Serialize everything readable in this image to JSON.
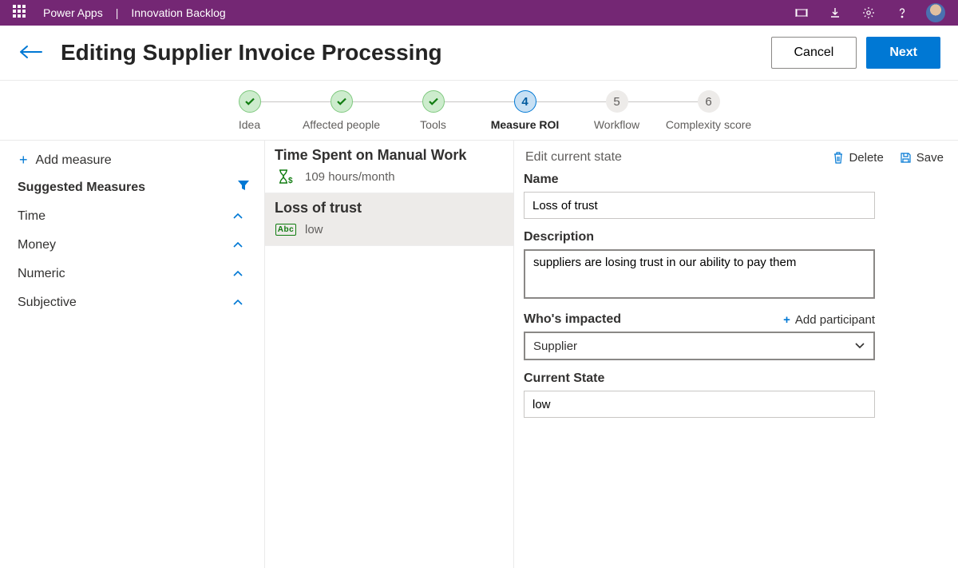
{
  "topbar": {
    "app": "Power Apps",
    "section": "Innovation Backlog"
  },
  "header": {
    "title": "Editing Supplier Invoice Processing",
    "cancel": "Cancel",
    "next": "Next"
  },
  "steps": [
    {
      "label": "Idea"
    },
    {
      "label": "Affected people"
    },
    {
      "label": "Tools"
    },
    {
      "label": "Measure ROI",
      "num": "4"
    },
    {
      "label": "Workflow",
      "num": "5"
    },
    {
      "label": "Complexity score",
      "num": "6"
    }
  ],
  "sidebar": {
    "add": "Add measure",
    "suggested": "Suggested Measures",
    "cats": [
      "Time",
      "Money",
      "Numeric",
      "Subjective"
    ]
  },
  "measures": [
    {
      "title": "Time Spent on Manual Work",
      "value": "109 hours/month",
      "iconType": "hourglass"
    },
    {
      "title": "Loss of trust",
      "value": "low",
      "iconType": "abc"
    }
  ],
  "form": {
    "caption": "Edit current state",
    "delete": "Delete",
    "save": "Save",
    "name_label": "Name",
    "name": "Loss of trust",
    "desc_label": "Description",
    "desc": "suppliers are losing trust in our ability to pay them",
    "impacted_label": "Who's impacted",
    "add_participant": "Add participant",
    "impacted": "Supplier",
    "state_label": "Current State",
    "state": "low"
  }
}
